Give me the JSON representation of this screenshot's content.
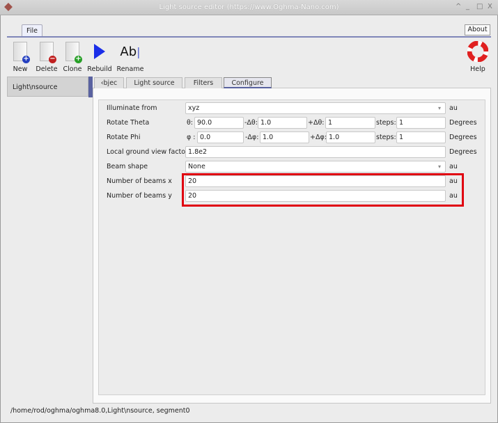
{
  "window": {
    "title": "Light source editor (https://www.Oghma-Nano.com)",
    "controls": [
      "^",
      "_",
      "□",
      "X"
    ]
  },
  "ribbon": {
    "tab": "File",
    "about": "About",
    "tools": [
      {
        "label": "New",
        "icon": "new-file-icon"
      },
      {
        "label": "Delete",
        "icon": "delete-file-icon"
      },
      {
        "label": "Clone",
        "icon": "clone-file-icon"
      },
      {
        "label": "Rebuild",
        "icon": "play-icon"
      },
      {
        "label": "Rename",
        "icon": "rename-icon",
        "glyph": "Ab"
      }
    ],
    "help": "Help"
  },
  "sidebar": {
    "items": [
      "Light\\nsource"
    ]
  },
  "tabs": [
    "‹bjec",
    "Light source",
    "Filters",
    "Configure"
  ],
  "form": {
    "illuminate": {
      "label": "Illuminate from",
      "value": "xyz",
      "unit": "au"
    },
    "theta": {
      "label": "Rotate Theta",
      "p1": "θ:",
      "v1": "90.0",
      "p2": "-Δθ:",
      "v2": "1.0",
      "p3": "+Δθ:",
      "v3": "1",
      "p4": "steps:",
      "v4": "1",
      "unit": "Degrees"
    },
    "phi": {
      "label": "Rotate Phi",
      "p1": "φ :",
      "v1": "0.0",
      "p2": "-Δφ:",
      "v2": "1.0",
      "p3": "+Δφ:",
      "v3": "1.0",
      "p4": "steps:",
      "v4": "1",
      "unit": "Degrees"
    },
    "ground": {
      "label": "Local ground view factor",
      "value": "1.8e2",
      "unit": "Degrees"
    },
    "beam": {
      "label": "Beam shape",
      "value": "None",
      "unit": "au"
    },
    "nx": {
      "label": "Number of beams x",
      "value": "20",
      "unit": "au"
    },
    "ny": {
      "label": "Number of beams y",
      "value": "20",
      "unit": "au"
    }
  },
  "status": "/home/rod/oghma/oghma8.0,Light\\nsource, segment0"
}
